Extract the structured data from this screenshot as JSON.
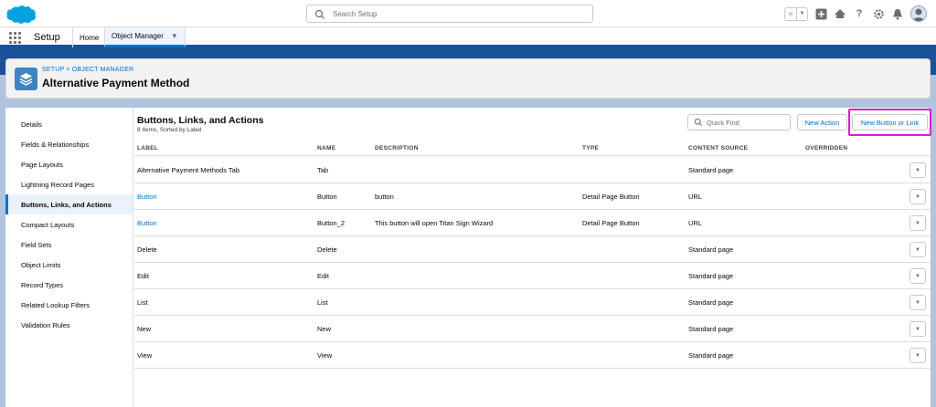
{
  "global_header": {
    "search_placeholder": "Search Setup"
  },
  "app_nav": {
    "app_name": "Setup",
    "tabs": [
      {
        "label": "Home"
      },
      {
        "label": "Object Manager"
      }
    ]
  },
  "page_header": {
    "breadcrumb": "SETUP > OBJECT MANAGER",
    "title": "Alternative Payment Method"
  },
  "sidebar": {
    "items": [
      {
        "label": "Details"
      },
      {
        "label": "Fields & Relationships"
      },
      {
        "label": "Page Layouts"
      },
      {
        "label": "Lightning Record Pages"
      },
      {
        "label": "Buttons, Links, and Actions"
      },
      {
        "label": "Compact Layouts"
      },
      {
        "label": "Field Sets"
      },
      {
        "label": "Object Limits"
      },
      {
        "label": "Record Types"
      },
      {
        "label": "Related Lookup Filters"
      },
      {
        "label": "Validation Rules"
      }
    ],
    "active_index": 4
  },
  "content": {
    "title": "Buttons, Links, and Actions",
    "subtitle": "8 Items, Sorted by Label",
    "quick_find_placeholder": "Quick Find",
    "new_action_label": "New Action",
    "new_button_label": "New Button or Link",
    "columns": [
      "LABEL",
      "NAME",
      "DESCRIPTION",
      "TYPE",
      "CONTENT SOURCE",
      "OVERRIDDEN"
    ],
    "rows": [
      {
        "label": "Alternative Payment Methods Tab",
        "name": "Tab",
        "description": "",
        "type": "",
        "content_source": "Standard page",
        "overridden": ""
      },
      {
        "label": "Button",
        "name": "Button",
        "description": "button",
        "type": "Detail Page Button",
        "content_source": "URL",
        "overridden": ""
      },
      {
        "label": "Button",
        "name": "Button_2",
        "description": "This button will open Titan Sign Wizard",
        "type": "Detail Page Button",
        "content_source": "URL",
        "overridden": ""
      },
      {
        "label": "Delete",
        "name": "Delete",
        "description": "",
        "type": "",
        "content_source": "Standard page",
        "overridden": ""
      },
      {
        "label": "Edit",
        "name": "Edit",
        "description": "",
        "type": "",
        "content_source": "Standard page",
        "overridden": ""
      },
      {
        "label": "List",
        "name": "List",
        "description": "",
        "type": "",
        "content_source": "Standard page",
        "overridden": ""
      },
      {
        "label": "New",
        "name": "New",
        "description": "",
        "type": "",
        "content_source": "Standard page",
        "overridden": ""
      },
      {
        "label": "View",
        "name": "View",
        "description": "",
        "type": "",
        "content_source": "Standard page",
        "overridden": ""
      }
    ]
  },
  "colors": {
    "brand_blue": "#1b5297",
    "link_blue": "#0070d2",
    "highlight_magenta": "#d61fd6"
  }
}
